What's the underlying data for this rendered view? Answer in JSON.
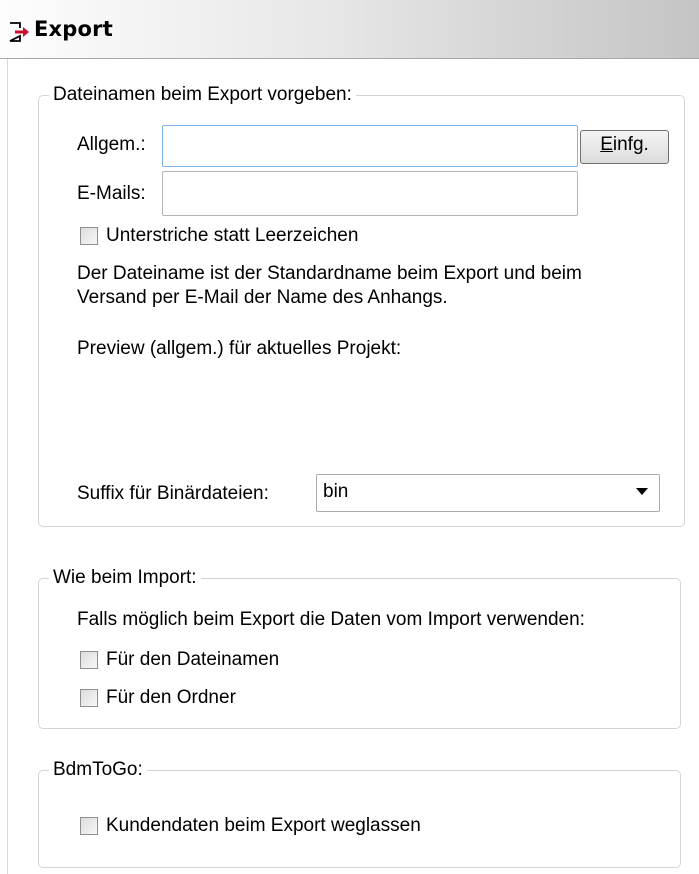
{
  "panel": {
    "title": "Export",
    "icon": "export-arrow-icon"
  },
  "filenames": {
    "legend": "Dateinamen beim Export vorgeben:",
    "general_label": "Allgem.:",
    "general_value": "",
    "insert_button_mnemonic": "E",
    "insert_button_rest": "infg.",
    "email_label": "E-Mails:",
    "email_value": "",
    "underscore_checkbox": {
      "label": "Unterstriche statt Leerzeichen",
      "checked": false
    },
    "description_line1": "Der Dateiname ist der Standardname beim Export und  beim",
    "description_line2": "Versand per E-Mail der Name des Anhangs.",
    "preview_label": "Preview (allgem.) für aktuelles Projekt:",
    "suffix_label": "Suffix für Binärdateien:",
    "suffix_value": "bin"
  },
  "import": {
    "legend": "Wie beim Import:",
    "description": "Falls möglich beim Export die Daten vom Import verwenden:",
    "filename_checkbox": {
      "label": "Für den Dateinamen",
      "checked": false
    },
    "folder_checkbox": {
      "label": "Für den Ordner",
      "checked": false
    }
  },
  "bdmtogo": {
    "legend": "BdmToGo:",
    "omit_customer_checkbox": {
      "label": "Kundendaten beim Export weglassen",
      "checked": false
    }
  }
}
